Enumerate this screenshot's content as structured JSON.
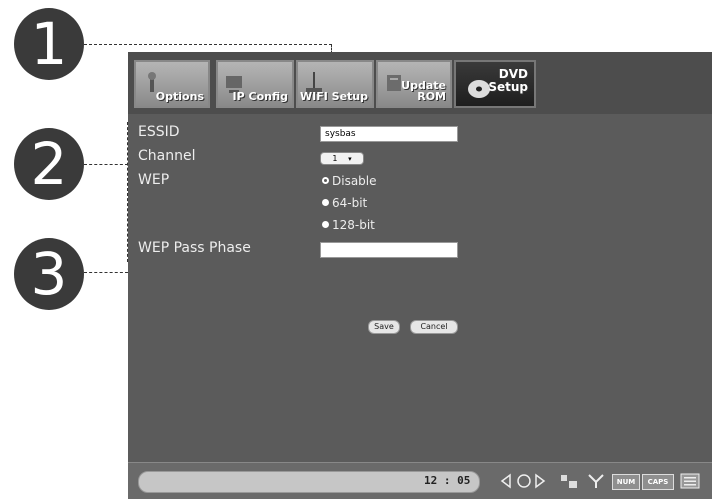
{
  "callouts": [
    "1",
    "2",
    "3"
  ],
  "toolbar": {
    "items": [
      {
        "label": "Options",
        "icon": "options-icon"
      },
      {
        "label": "IP Config",
        "icon": "ip-config-icon"
      },
      {
        "label": "WIFI Setup",
        "icon": "wifi-setup-icon"
      },
      {
        "label": "Update ROM",
        "icon": "update-rom-icon"
      },
      {
        "label": "DVD Setup",
        "icon": "dvd-disc-icon"
      }
    ]
  },
  "form": {
    "essid_label": "ESSID",
    "essid_value": "sysbas",
    "channel_label": "Channel",
    "channel_value": "1",
    "wep_label": "WEP",
    "wep_options": [
      "Disable",
      "64-bit",
      "128-bit"
    ],
    "wep_selected": "Disable",
    "passphrase_label": "WEP Pass Phase",
    "passphrase_value": "",
    "save_label": "Save",
    "cancel_label": "Cancel"
  },
  "statusbar": {
    "time": "12 : 05",
    "num_label": "NUM",
    "caps_label": "CAPS"
  }
}
